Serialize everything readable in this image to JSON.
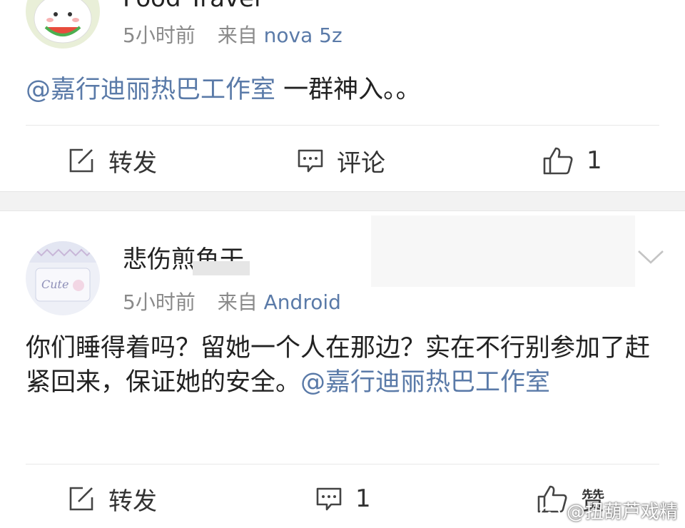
{
  "post1": {
    "username": "Food Travel",
    "time": "5小时前",
    "from_label": "来自",
    "source": "nova 5z",
    "mention": "@嘉行迪丽热巴工作室",
    "text": " 一群神入。。",
    "actions": {
      "repost": "转发",
      "comment": "评论",
      "like_count": "1"
    }
  },
  "post2": {
    "username": "悲伤煎鱼干",
    "time": "5小时前",
    "from_label": "来自",
    "source": "Android",
    "text": "你们睡得着吗？留她一个人在那边？实在不行别参加了赶紧回来，保证她的安全。",
    "mention": "@嘉行迪丽热巴工作室",
    "actions": {
      "repost": "转发",
      "comment_count": "1",
      "like": "赞"
    }
  },
  "watermark": "@扭葫芦戏精",
  "colors": {
    "link": "#5a7aa8",
    "meta": "#8a8a8a",
    "separator": "#f2f2f2"
  },
  "icons": {
    "repost": "edit-square-icon",
    "comment": "comment-bubble-icon",
    "like": "thumbs-up-icon",
    "more": "chevron-down-icon",
    "watermark": "weibo-logo-icon"
  }
}
